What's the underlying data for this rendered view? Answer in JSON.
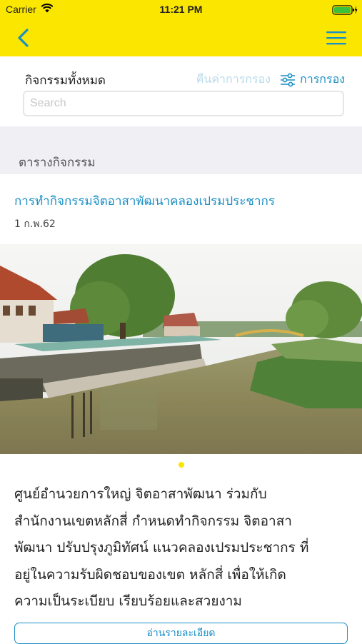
{
  "status_bar": {
    "carrier": "Carrier",
    "time": "11:21 PM",
    "wifi_icon": "wifi-icon",
    "battery_icon": "battery-charging-icon"
  },
  "nav": {
    "back_icon": "chevron-left-icon",
    "menu_icon": "hamburger-menu-icon",
    "background_color": "#fbe600",
    "accent_color": "#1a8fc6"
  },
  "filter": {
    "all_activities_label": "กิจกรรมทั้งหมด",
    "reset_label": "คืนค่าการกรอง",
    "filter_label": "การกรอง",
    "filter_icon": "sliders-icon"
  },
  "search": {
    "placeholder": "Search",
    "value": ""
  },
  "section": {
    "title": "ตารางกิจกรรม"
  },
  "activity": {
    "title": "การทำกิจกรรมจิตอาสาพัฒนาคลองเปรมประชากร",
    "date": "1 ก.พ.62",
    "photo": "canal-river-photo",
    "page_indicator": {
      "current": 1,
      "total": 1
    },
    "description_lines": [
      "ศูนย์อำนวยการใหญ่ จิตอาสาพัฒนา ร่วมกับ",
      "สำนักงานเขตหลักสี่  กำหนดทำกิจกรรม จิตอาสา",
      "พัฒนา ปรับปรุงภูมิทัศน์ แนวคลองเปรมประชากร ที่",
      "อยู่ในความรับผิดชอบของเขต หลักสี่  เพื่อให้เกิด",
      "ความเป็นระเบียบ เรียบร้อยและสวยงาม"
    ],
    "read_more_label": "อ่านรายละเอียด"
  }
}
